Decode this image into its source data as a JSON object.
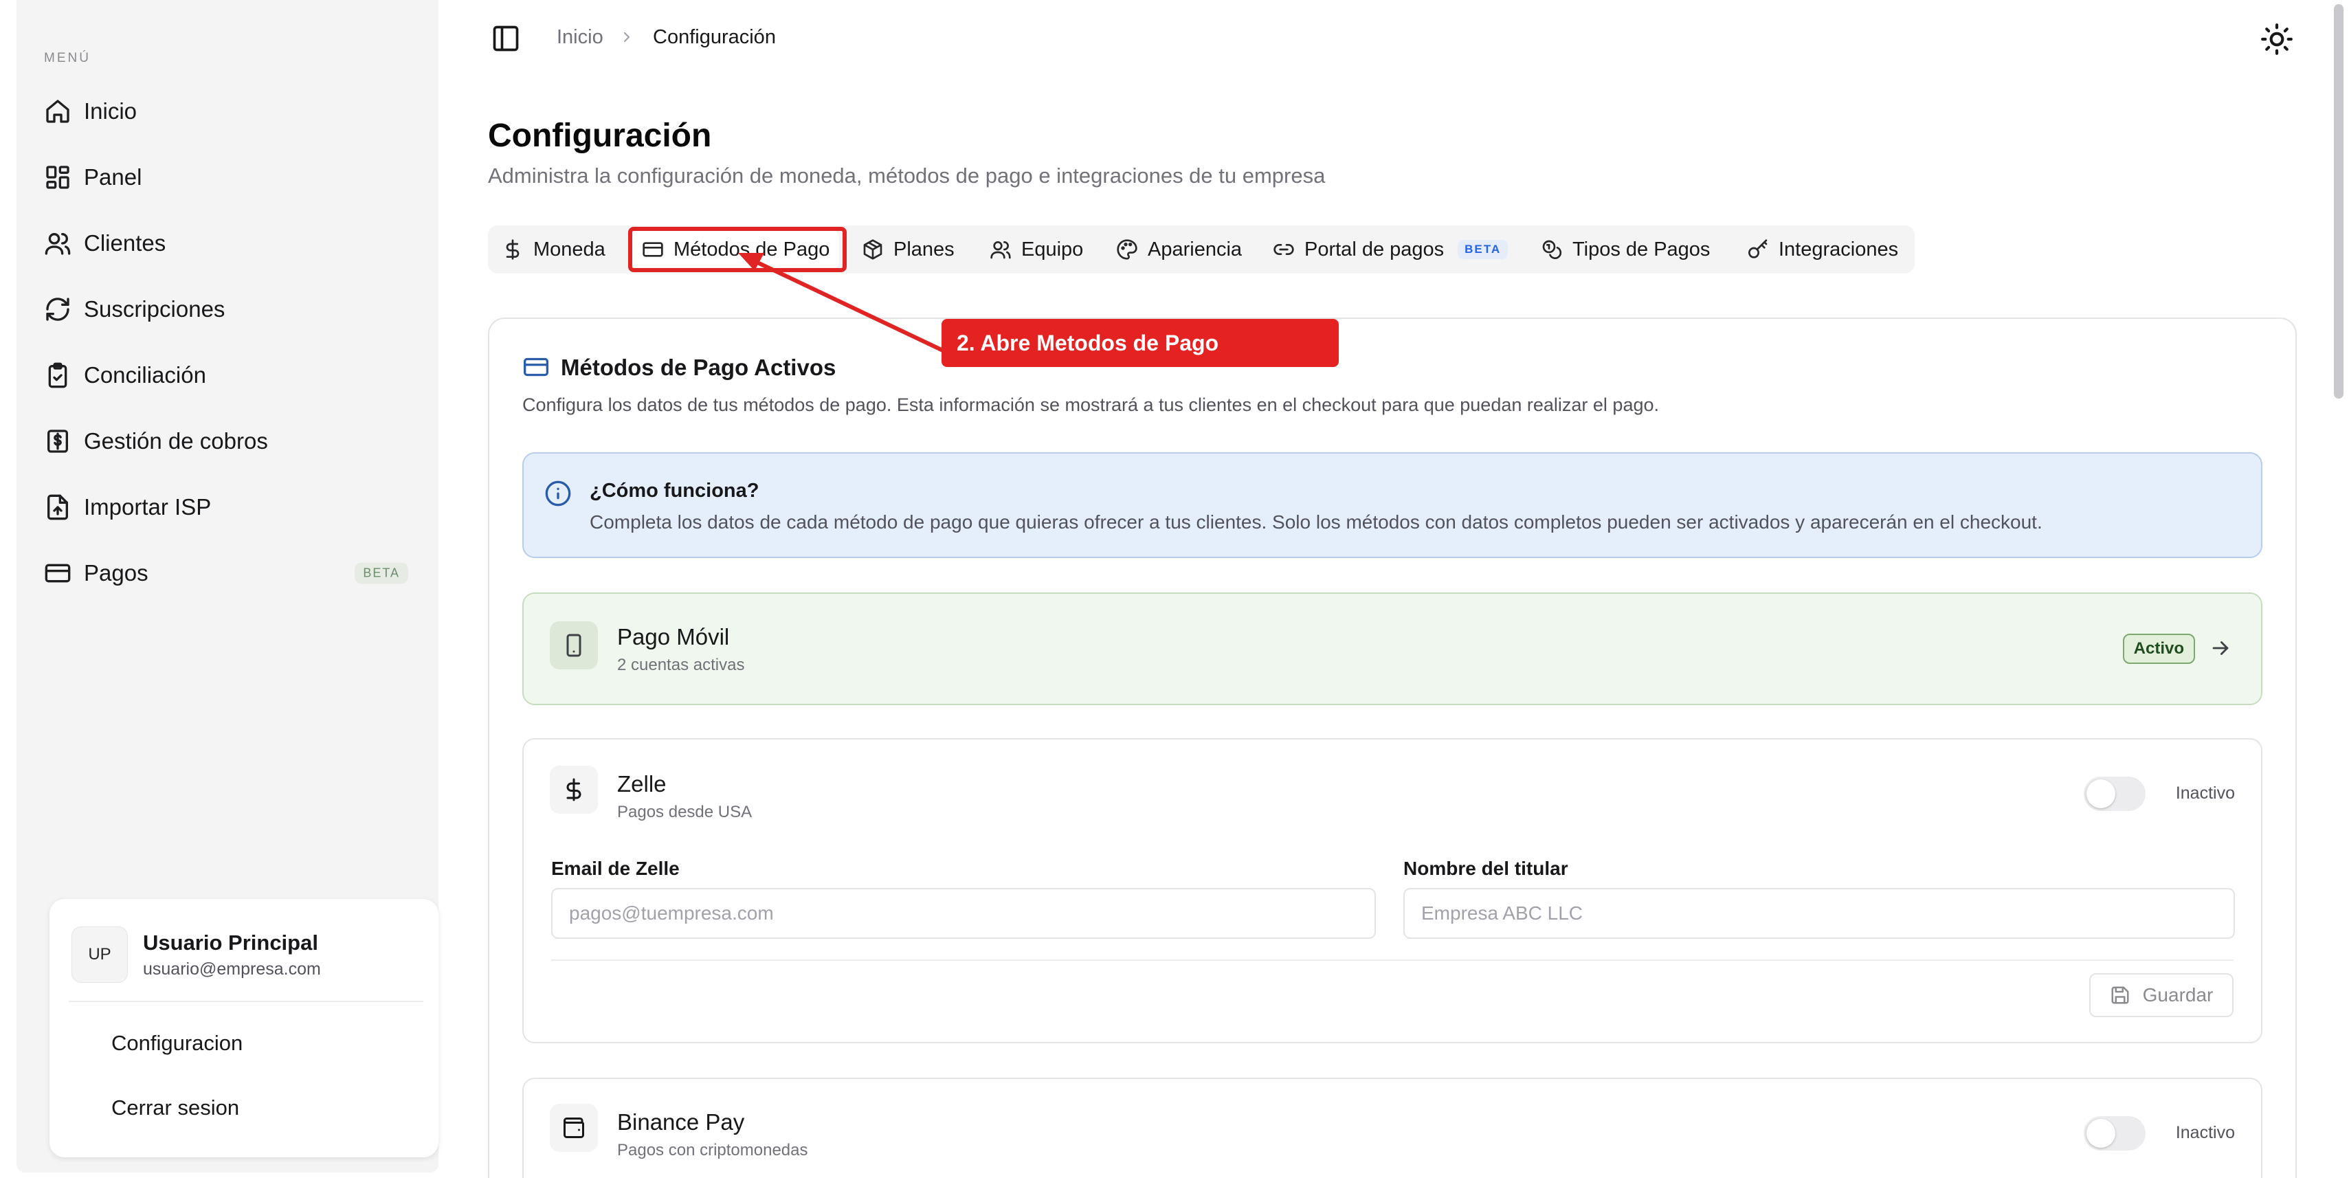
{
  "sidebar": {
    "menu_label": "MENÚ",
    "items": [
      {
        "label": "Inicio",
        "icon": "home-icon"
      },
      {
        "label": "Panel",
        "icon": "layout-dashboard-icon"
      },
      {
        "label": "Clientes",
        "icon": "users-icon"
      },
      {
        "label": "Suscripciones",
        "icon": "refresh-icon"
      },
      {
        "label": "Conciliación",
        "icon": "clipboard-check-icon"
      },
      {
        "label": "Gestión de cobros",
        "icon": "receipt-dollar-icon"
      },
      {
        "label": "Importar ISP",
        "icon": "file-upload-icon"
      },
      {
        "label": "Pagos",
        "icon": "credit-card-icon",
        "badge": "BETA"
      }
    ],
    "user": {
      "initials": "UP",
      "name": "Usuario Principal",
      "email": "usuario@empresa.com",
      "config_link": "Configuracion",
      "logout_link": "Cerrar sesion"
    }
  },
  "header": {
    "breadcrumb_home": "Inicio",
    "breadcrumb_current": "Configuración"
  },
  "page": {
    "title": "Configuración",
    "subtitle": "Administra la configuración de moneda, métodos de pago e integraciones de tu empresa"
  },
  "tabs": [
    {
      "label": "Moneda",
      "icon": "dollar-icon"
    },
    {
      "label": "Métodos de Pago",
      "icon": "credit-card-icon",
      "active": true
    },
    {
      "label": "Planes",
      "icon": "package-icon"
    },
    {
      "label": "Equipo",
      "icon": "users-icon"
    },
    {
      "label": "Apariencia",
      "icon": "palette-icon"
    },
    {
      "label": "Portal de pagos",
      "icon": "link-icon",
      "badge": "BETA"
    },
    {
      "label": "Tipos de Pagos",
      "icon": "coins-icon"
    },
    {
      "label": "Integraciones",
      "icon": "key-icon"
    }
  ],
  "annotation": {
    "label": "2. Abre Metodos de Pago",
    "color": "#e52222"
  },
  "section": {
    "title": "Métodos de Pago Activos",
    "description": "Configura los datos de tus métodos de pago. Esta información se mostrará a tus clientes en el checkout para que puedan realizar el pago."
  },
  "info": {
    "title": "¿Cómo funciona?",
    "text": "Completa los datos de cada método de pago que quieras ofrecer a tus clientes. Solo los métodos con datos completos pueden ser activados y aparecerán en el checkout."
  },
  "methods": {
    "pago_movil": {
      "title": "Pago Móvil",
      "subtitle": "2 cuentas activas",
      "status": "Activo"
    },
    "zelle": {
      "title": "Zelle",
      "subtitle": "Pagos desde USA",
      "status": "Inactivo",
      "email_label": "Email de Zelle",
      "email_placeholder": "pagos@tuempresa.com",
      "holder_label": "Nombre del titular",
      "holder_placeholder": "Empresa ABC LLC",
      "save_label": "Guardar"
    },
    "binance": {
      "title": "Binance Pay",
      "subtitle": "Pagos con criptomonedas",
      "status": "Inactivo"
    }
  },
  "colors": {
    "accent_blue": "#2a5caa",
    "active_green_bg": "#f0f7ee",
    "highlight_red": "#e02424"
  }
}
